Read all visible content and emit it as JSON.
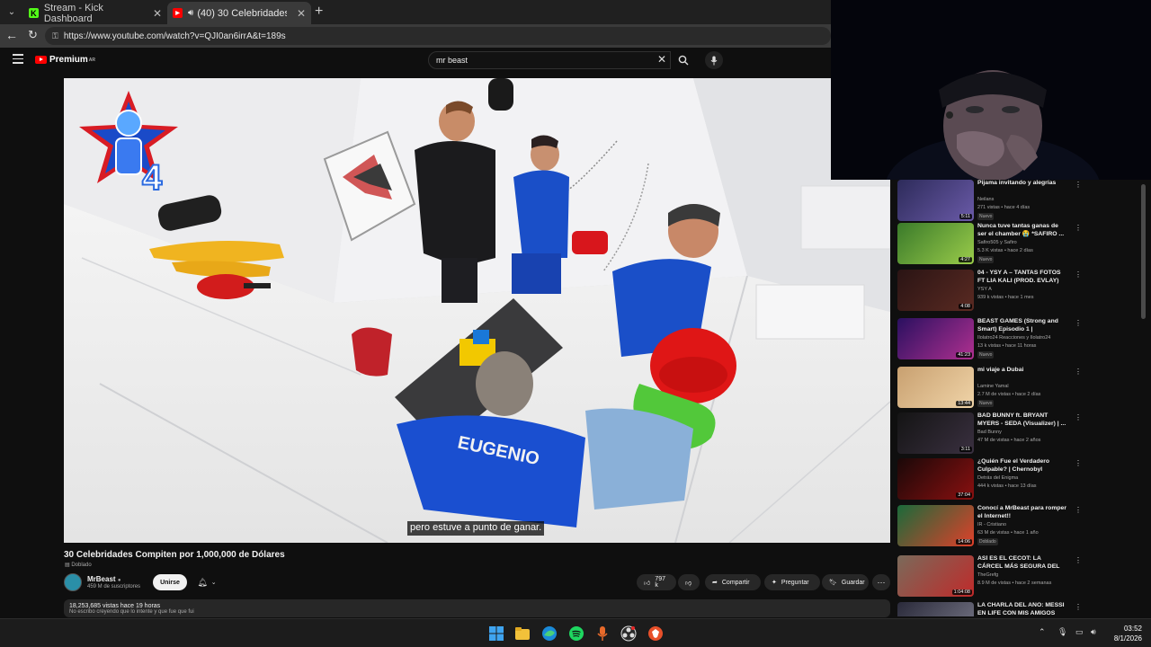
{
  "browser": {
    "tabs": [
      {
        "title": "Stream - Kick Dashboard",
        "favicon": "K",
        "color": "#53fc18"
      },
      {
        "title": "(40) 30 Celebridades Compite...",
        "favicon": "yt",
        "color": "#ff0000"
      }
    ],
    "url": "https://www.youtube.com/watch?v=QJI0an6irrA&t=189s"
  },
  "youtube": {
    "logo_text": "Premium",
    "logo_region": "AR",
    "search_query": "mr beast"
  },
  "video": {
    "subtitle": "pero estuve a punto de ganar.",
    "badge_number": "4",
    "title": "30 Celebridades Compiten por 1,000,000 de Dólares",
    "dubbed": "Doblado",
    "shirt_text": "EUGENIO"
  },
  "channel": {
    "name": "MrBeast",
    "subscribers": "459 M de suscriptores",
    "join_label": "Unirse"
  },
  "actions": {
    "likes": "797 k",
    "share": "Compartir",
    "ask": "Preguntar",
    "save": "Guardar"
  },
  "description": {
    "stats": "18,253,685 vistas  hace 19 horas",
    "preview": "No escribo creyendo que lo intente y que fue que fui"
  },
  "recommendations": [
    {
      "title": "Pijama invitando y alegrías",
      "channel": "Neilans",
      "meta": "271 vistas • hace 4 días",
      "badge": "Nuevo",
      "duration": "5:11",
      "colors": [
        "#2d2b5a",
        "#6a5aa8"
      ]
    },
    {
      "title": "Nunca tuve tantas ganas de ser el chamber 😭 *SAFIRO ...",
      "channel": "Safiro505 y Safiro",
      "meta": "5.3 K vistas • hace 2 días",
      "badge": "Nuevo",
      "duration": "4:27",
      "colors": [
        "#3a7a2a",
        "#9acc4a"
      ]
    },
    {
      "title": "04 - YSY A – TANTAS FOTOS FT LIA KALI (PROD. EVLAY)",
      "channel": "YSY A",
      "meta": "939 k vistas • hace 1 mes",
      "badge": "",
      "duration": "4:08",
      "colors": [
        "#2a1414",
        "#5a2a22"
      ]
    },
    {
      "title": "BEAST GAMES (Strong and Smart) Episodio 1 | REACCIÓ...",
      "channel": "Ilolatro24 Reacciones y Ilolatro24",
      "meta": "13 k vistas • hace 11 horas",
      "badge": "Nuevo",
      "duration": "41:23",
      "colors": [
        "#2a1060",
        "#b03090"
      ]
    },
    {
      "title": "mi viaje a Dubai",
      "channel": "Lamine Yamal",
      "meta": "2.7 M de vistas • hace 2 días",
      "badge": "Nuevo",
      "duration": "13:44",
      "colors": [
        "#c8a070",
        "#f0d4a8"
      ]
    },
    {
      "title": "BAD BUNNY ft. BRYANT MYERS - SEDA (Visualizer) | ...",
      "channel": "Bad Bunny",
      "meta": "47 M de vistas • hace 2 años",
      "badge": "",
      "duration": "3:11",
      "colors": [
        "#141414",
        "#3a3040"
      ]
    },
    {
      "title": "¿Quién Fue el Verdadero Culpable? | Chernobyl",
      "channel": "Detrás del Enigma",
      "meta": "444 k vistas • hace 13 días",
      "badge": "",
      "duration": "37:04",
      "colors": [
        "#1a0808",
        "#8a1010"
      ]
    },
    {
      "title": "Conocí a MrBeast para romper el Internet!!",
      "channel": "IR - Cristiano",
      "meta": "63 M de vistas • hace 1 año",
      "badge": "Doblado",
      "duration": "14:06",
      "colors": [
        "#1a6a3a",
        "#e0402a"
      ]
    },
    {
      "title": "ASÍ ES EL CECOT: LA CÁRCEL MÁS SEGURA DEL MUNDO",
      "channel": "TheGrefg",
      "meta": "8.9 M de vistas • hace 2 semanas",
      "badge": "",
      "duration": "1:04:08",
      "colors": [
        "#7a6a5a",
        "#c02a2a"
      ]
    },
    {
      "title": "LA CHARLA DEL AÑO: MESSI EN LIFE CON MIS AMIGOS LO...",
      "channel": "",
      "meta": "",
      "badge": "",
      "duration": "",
      "colors": [
        "#2a2a3a",
        "#7a7a8a"
      ]
    }
  ],
  "taskbar": {
    "time": "03:52",
    "date": "8/1/2026",
    "apps": [
      "windows-start",
      "file-explorer",
      "edge",
      "spotify",
      "microphone-app",
      "obs",
      "brave"
    ]
  }
}
